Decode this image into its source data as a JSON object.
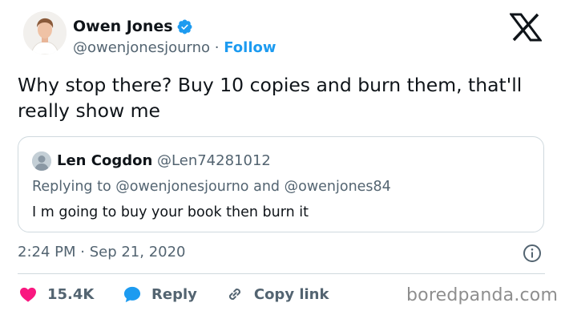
{
  "author": {
    "display_name": "Owen Jones",
    "handle": "@owenjonesjourno",
    "separator": "·",
    "follow_label": "Follow",
    "verified": true
  },
  "platform_logo": "x-logo-icon",
  "tweet": {
    "text": "Why stop there? Buy 10 copies and burn them, that'll really show me",
    "timestamp": "2:24 PM · Sep 21, 2020"
  },
  "quoted": {
    "name": "Len Cogdon",
    "handle": "@Len74281012",
    "replying_prefix": "Replying to",
    "replying_to_1": "@owenjonesjourno",
    "replying_and": "and",
    "replying_to_2": "@owenjones84",
    "text": "I m going to buy your book then burn it"
  },
  "actions": {
    "like_count": "15.4K",
    "reply_label": "Reply",
    "copy_link_label": "Copy link"
  },
  "watermark": "boredpanda.com",
  "colors": {
    "accent": "#1d9bf0",
    "like": "#f91880",
    "text": "#0f1419",
    "muted": "#536471",
    "border": "#cfd9de"
  }
}
